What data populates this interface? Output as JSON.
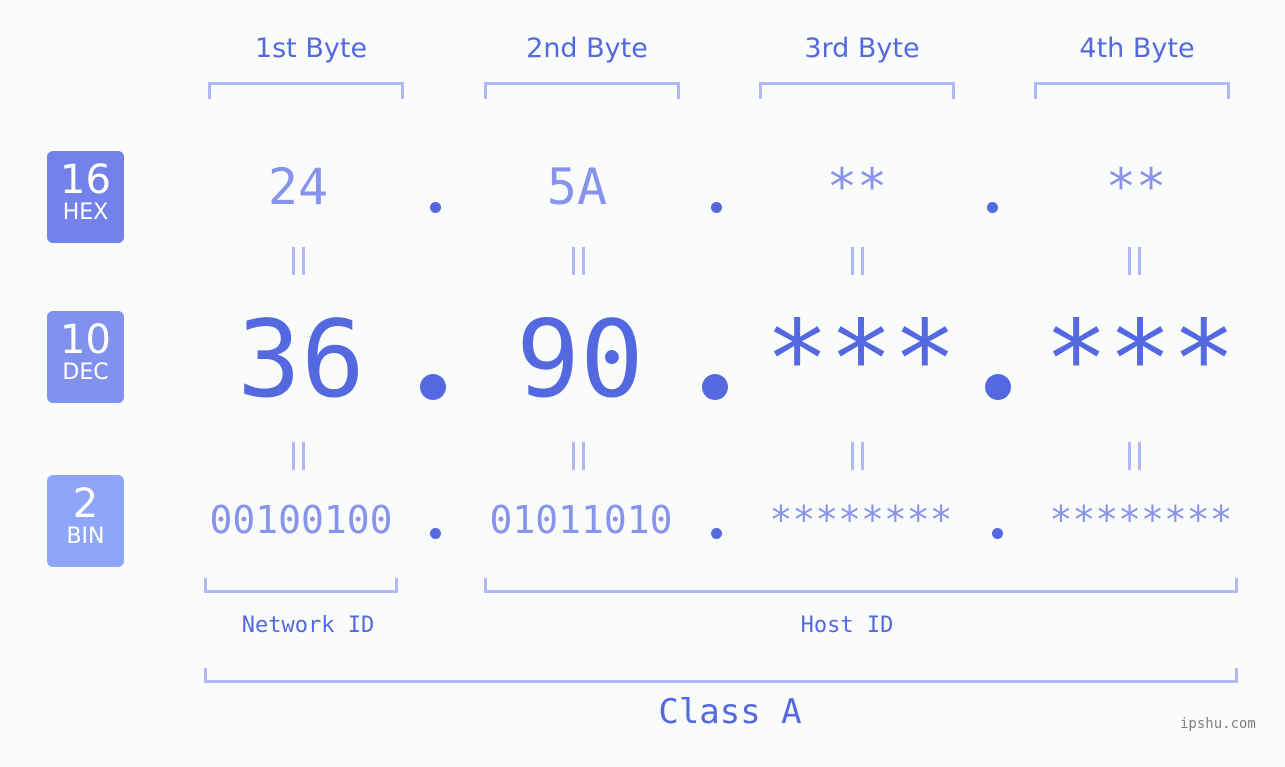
{
  "byte_headers": [
    "1st Byte",
    "2nd Byte",
    "3rd Byte",
    "4th Byte"
  ],
  "badges": [
    {
      "base": "16",
      "label": "HEX",
      "color": "#7282ea"
    },
    {
      "base": "10",
      "label": "DEC",
      "color": "#8091ee"
    },
    {
      "base": "2",
      "label": "BIN",
      "color": "#8fa6f8"
    }
  ],
  "hex": [
    "24",
    "5A",
    "**",
    "**"
  ],
  "dec": [
    "36",
    "90",
    "***",
    "***"
  ],
  "bin": [
    "00100100",
    "01011010",
    "********",
    "********"
  ],
  "equals_sign": "||",
  "network_id_label": "Network ID",
  "host_id_label": "Host ID",
  "class_label": "Class A",
  "watermark": "ipshu.com"
}
